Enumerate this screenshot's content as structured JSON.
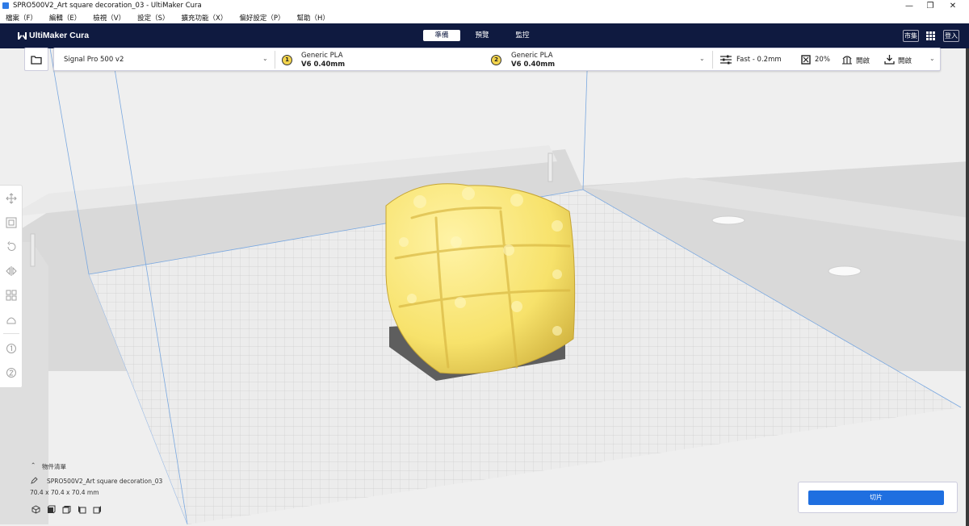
{
  "window": {
    "title": "SPRO500V2_Art square decoration_03 - UltiMaker Cura",
    "minimize": "—",
    "restore": "❐",
    "close": "✕"
  },
  "menu": [
    {
      "label": "檔案（F）"
    },
    {
      "label": "編輯（E）"
    },
    {
      "label": "檢視（V）"
    },
    {
      "label": "設定（S）"
    },
    {
      "label": "擴充功能（X）"
    },
    {
      "label": "偏好設定（P）"
    },
    {
      "label": "幫助（H）"
    }
  ],
  "header": {
    "logo": "UltiMaker Cura",
    "tabs": [
      {
        "label": "準備",
        "active": true
      },
      {
        "label": "預覽",
        "active": false
      },
      {
        "label": "監控",
        "active": false
      }
    ],
    "marketplace": "市集",
    "login": "登入"
  },
  "toolbar": {
    "printer": "Signal Pro 500 v2",
    "extruder1": {
      "num": "1",
      "material": "Generic PLA",
      "nozzle": "V6 0.40mm"
    },
    "extruder2": {
      "num": "2",
      "material": "Generic PLA",
      "nozzle": "V6 0.40mm"
    },
    "profile": "Fast - 0.2mm",
    "infill": "20%",
    "support": "開啟",
    "adhesion": "開啟"
  },
  "objects": {
    "header": "物件清單",
    "name": "SPRO500V2_Art square decoration_03",
    "dimensions": "70.4 x 70.4 x 70.4 mm"
  },
  "slice": {
    "button": "切片"
  },
  "colors": {
    "header_bg": "#0f1a40",
    "model": "#f7e26b",
    "slice_button": "#1f6fe0"
  }
}
